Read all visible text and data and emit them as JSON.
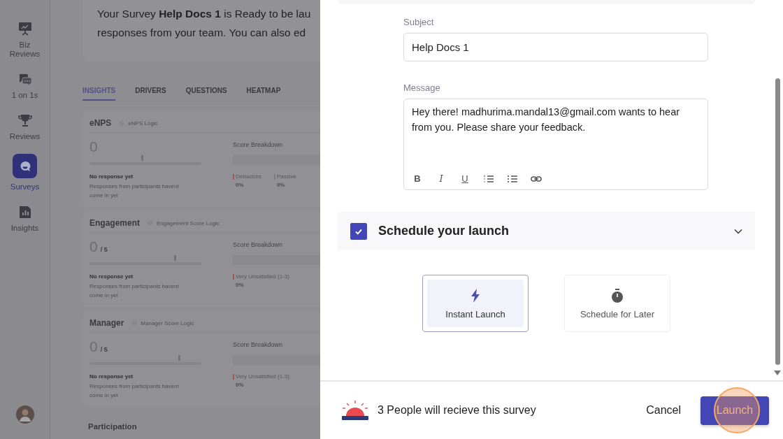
{
  "sidebar": {
    "items": [
      {
        "label": "Biz Reviews",
        "selected": false
      },
      {
        "label": "1 on 1s",
        "selected": false
      },
      {
        "label": "Reviews",
        "selected": false
      },
      {
        "label": "Surveys",
        "selected": true
      },
      {
        "label": "Insights",
        "selected": false
      }
    ]
  },
  "banner": {
    "lines": [
      "Your Survey **Help Docs 1** is Ready to be lau",
      "responses from your team. You can also ed"
    ]
  },
  "tabs": [
    {
      "label": "INSIGHTS",
      "selected": true
    },
    {
      "label": "DRIVERS",
      "selected": false
    },
    {
      "label": "QUESTIONS",
      "selected": false
    },
    {
      "label": "HEATMAP",
      "selected": false
    }
  ],
  "metrics": [
    {
      "title": "eNPS",
      "logic": "eNPS Logic",
      "score": "0",
      "level": 0.47,
      "status": "No response yet",
      "note": "Responses from participants havent come in yet",
      "breakdown_title": "Score Breakdown",
      "legend": [
        {
          "label": "Detractors",
          "value": "0%",
          "color": "#a0545a"
        },
        {
          "label": "Passive",
          "value": "0%",
          "color": "#7c7c80"
        }
      ]
    },
    {
      "title": "Engagement",
      "logic": "Engagement Score Logic",
      "score": "0",
      "out_of": "/ 5",
      "level": 0.76,
      "status": "No response yet",
      "note": "Responses from participants havent come in yet",
      "breakdown_title": "Score Breakdown",
      "legend": [
        {
          "label": "Very Unsatisfied (1-3)",
          "value": "0%",
          "color": "#a0545a"
        }
      ]
    },
    {
      "title": "Manager",
      "logic": "Manager Score Logic",
      "score": "0",
      "out_of": "/ 5",
      "level": 0.8,
      "status": "No response yet",
      "note": "Responses from participants havent come in yet",
      "breakdown_title": "Score Breakdown",
      "legend": [
        {
          "label": "Very Unsatisfied (1-3)",
          "value": "0%",
          "color": "#a0545a"
        }
      ]
    }
  ],
  "participation": {
    "title": "Participation"
  },
  "panel": {
    "subject": {
      "label": "Subject",
      "value": "Help Docs 1"
    },
    "message": {
      "label": "Message",
      "value": "Hey there! madhurima.mandal13@gmail.com wants to hear from you. Please share your feedback.",
      "format_buttons": [
        "B",
        "I",
        "U"
      ]
    },
    "schedule": {
      "checked": true,
      "title": "Schedule your launch"
    },
    "options": [
      {
        "label": "Instant Launch",
        "selected": true
      },
      {
        "label": "Schedule for Later",
        "selected": false
      }
    ],
    "footer": {
      "recipients": "3 People will recieve this survey",
      "cancel": "Cancel",
      "launch": "Launch"
    }
  }
}
